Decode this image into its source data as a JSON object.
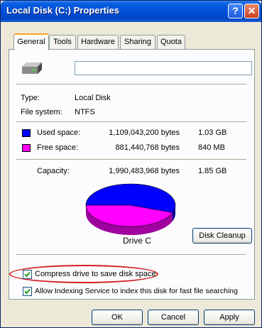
{
  "window": {
    "title": "Local Disk (C:) Properties",
    "help_glyph": "?",
    "close_glyph": "✕"
  },
  "tabs": [
    {
      "label": "General",
      "active": true
    },
    {
      "label": "Tools",
      "active": false
    },
    {
      "label": "Hardware",
      "active": false
    },
    {
      "label": "Sharing",
      "active": false
    },
    {
      "label": "Quota",
      "active": false
    }
  ],
  "general": {
    "drive_name_value": "",
    "type_label": "Type:",
    "type_value": "Local Disk",
    "fs_label": "File system:",
    "fs_value": "NTFS",
    "used": {
      "label": "Used space:",
      "bytes": "1,109,043,200 bytes",
      "size": "1.03 GB",
      "color": "#0000ff"
    },
    "free": {
      "label": "Free space:",
      "bytes": "881,440,768 bytes",
      "size": "840 MB",
      "color": "#ff00ff"
    },
    "capacity": {
      "label": "Capacity:",
      "bytes": "1,990,483,968 bytes",
      "size": "1.85 GB"
    },
    "drive_label": "Drive C",
    "disk_cleanup_label": "Disk Cleanup",
    "used_fraction": 0.557
  },
  "options": {
    "compress_label": "Compress drive to save disk space",
    "compress_checked": true,
    "indexing_label": "Allow Indexing Service to index this disk for fast file searching",
    "indexing_checked": true
  },
  "buttons": {
    "ok": "OK",
    "cancel": "Cancel",
    "apply": "Apply"
  },
  "colors": {
    "title_blue": "#0050d8",
    "highlight": "#d32020"
  }
}
